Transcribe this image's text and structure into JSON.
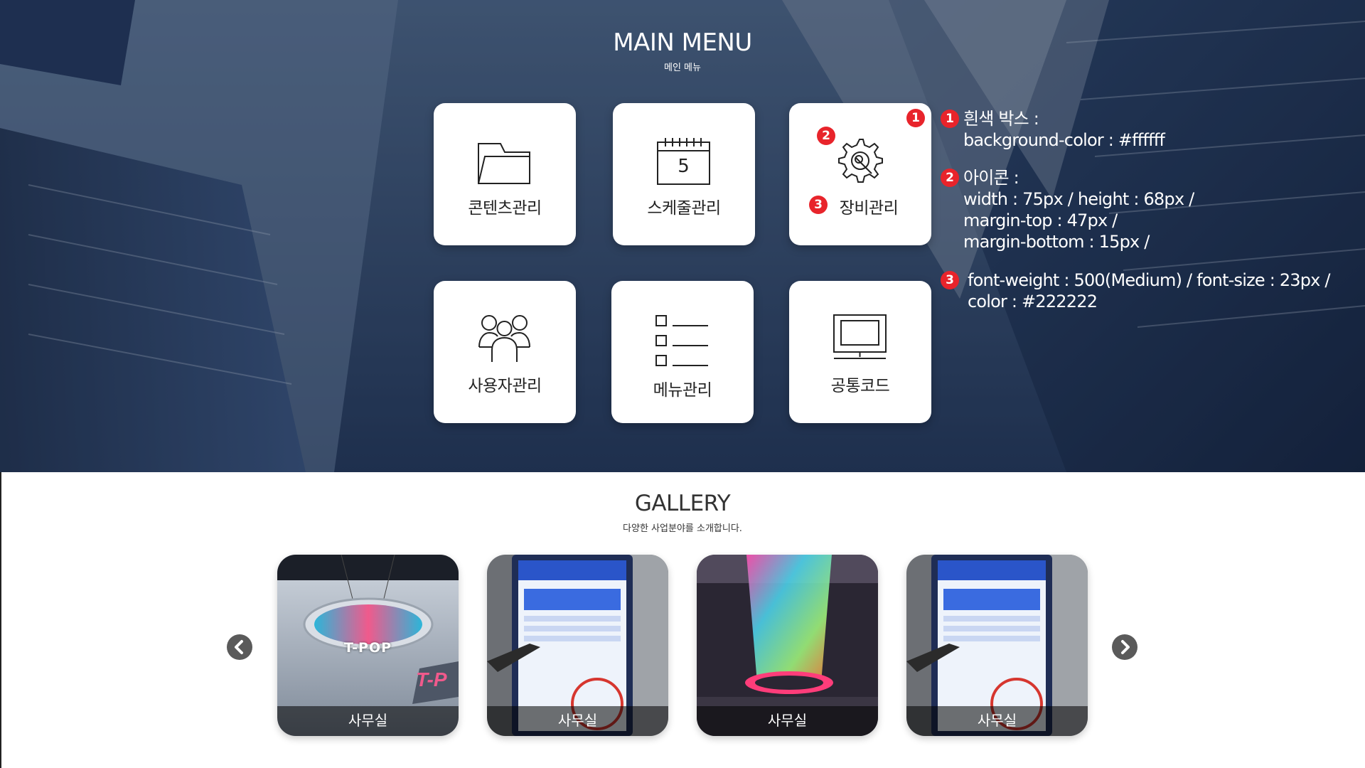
{
  "main_menu": {
    "title": "MAIN MENU",
    "subtitle": "메인 메뉴",
    "tiles": [
      {
        "label": "콘텐츠관리",
        "icon": "folder-icon"
      },
      {
        "label": "스케줄관리",
        "icon": "calendar-icon",
        "calendar_day": "5"
      },
      {
        "label": "장비관리",
        "icon": "gear-wrench-icon"
      },
      {
        "label": "사용자관리",
        "icon": "users-icon"
      },
      {
        "label": "메뉴관리",
        "icon": "list-icon"
      },
      {
        "label": "공통코드",
        "icon": "monitor-icon"
      }
    ]
  },
  "annotations": {
    "badge_1": "1",
    "badge_2": "2",
    "badge_3": "3",
    "note_1": [
      "흰색 박스 :",
      "background-color : #ffffff"
    ],
    "note_2": [
      "아이콘 :",
      "width : 75px / height : 68px /",
      "margin-top : 47px /",
      "margin-bottom : 15px /"
    ],
    "note_3": [
      "font-weight : 500(Medium) / font-size : 23px /",
      "color : #222222"
    ],
    "badge_color": "#e8242b"
  },
  "gallery": {
    "title": "GALLERY",
    "subtitle": "다양한 사업분야를 소개합니다.",
    "cards": [
      {
        "caption": "사무실",
        "image": "t-pop-led-display",
        "sign_text": "T-POP"
      },
      {
        "caption": "사무실",
        "image": "kiosk-screen"
      },
      {
        "caption": "사무실",
        "image": "led-chandelier"
      },
      {
        "caption": "사무실",
        "image": "kiosk-screen"
      }
    ],
    "prev_icon": "chevron-left-icon",
    "next_icon": "chevron-right-icon"
  }
}
